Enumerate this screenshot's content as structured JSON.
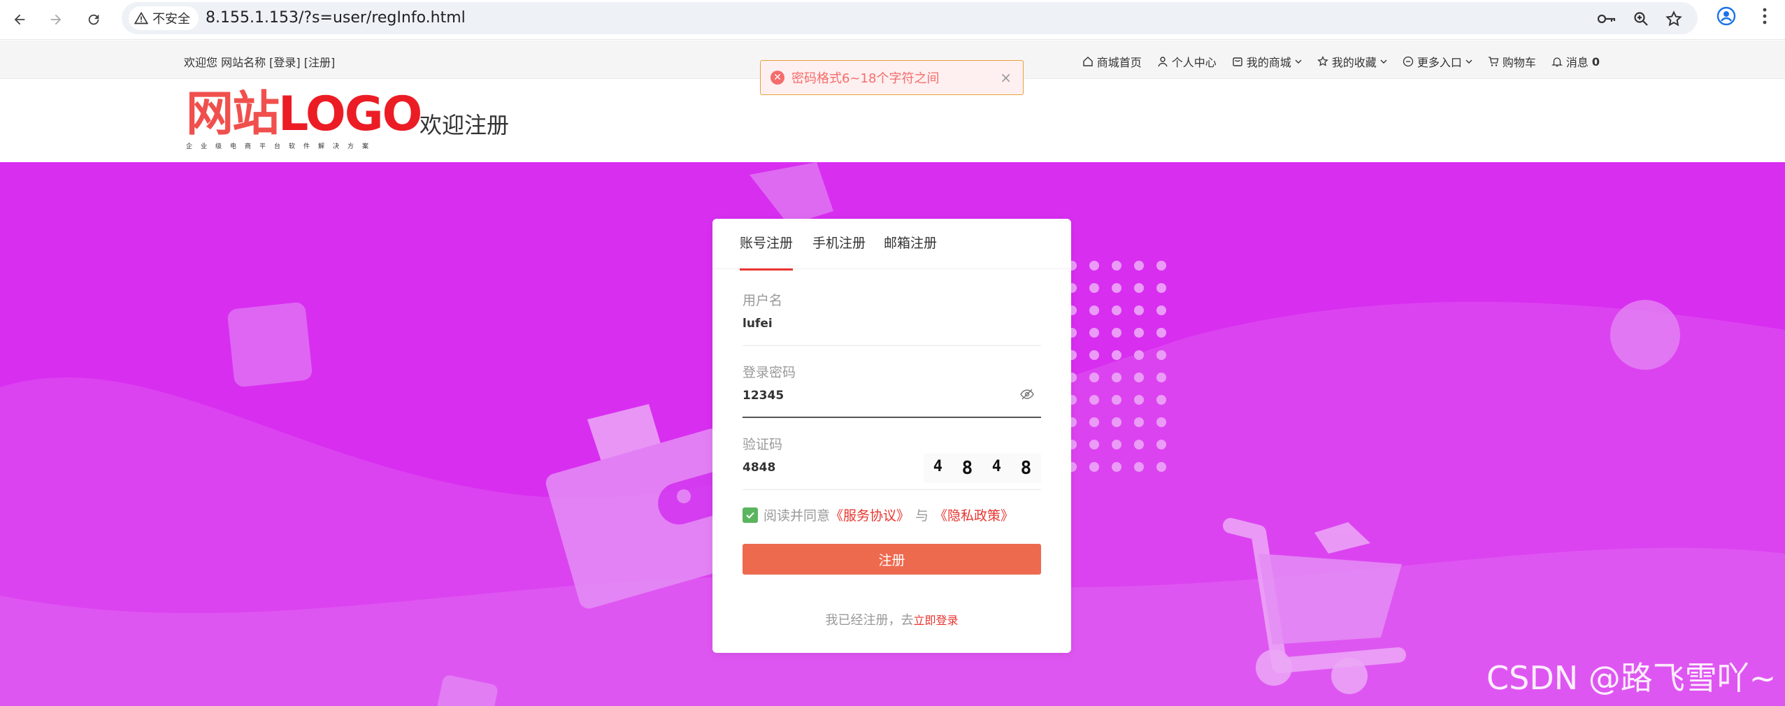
{
  "browser": {
    "security_label": "不安全",
    "url": "8.155.1.153/?s=user/regInfo.html"
  },
  "topnav": {
    "welcome": "欢迎您 网站名称 [登录] [注册]",
    "items": [
      {
        "label": "商城首页",
        "icon": "home-icon"
      },
      {
        "label": "个人中心",
        "icon": "user-icon"
      },
      {
        "label": "我的商城",
        "icon": "store-icon"
      },
      {
        "label": "我的收藏",
        "icon": "star-icon"
      },
      {
        "label": "更多入口",
        "icon": "more-icon"
      },
      {
        "label": "购物车",
        "icon": "cart-icon"
      },
      {
        "label": "消息",
        "icon": "bell-icon",
        "count": "0"
      }
    ]
  },
  "toast": {
    "message": "密码格式6~18个字符之间",
    "close": "×"
  },
  "header": {
    "logo_cn": "网站",
    "logo_en": "LOGO",
    "logo_sub": "企业级电商平台软件解决方案",
    "title": "欢迎注册"
  },
  "form": {
    "tabs": [
      "账号注册",
      "手机注册",
      "邮箱注册"
    ],
    "username_label": "用户名",
    "username_value": "lufei",
    "password_label": "登录密码",
    "password_value": "12345",
    "captcha_label": "验证码",
    "captcha_value": "4848",
    "captcha_chars": [
      "4",
      "8",
      "4",
      "8"
    ],
    "agree_text": "阅读并同意",
    "service_link": "《服务协议》",
    "and_text": "与",
    "privacy_link": "《隐私政策》",
    "submit_label": "注册",
    "login_hint": "我已经注册，去",
    "login_link": "立即登录"
  },
  "watermark": "CSDN @路飞雪吖~",
  "colors": {
    "hero": "#d82ef0",
    "accent": "#e8342f",
    "button": "#ed6a4f",
    "check": "#5ab55e"
  }
}
